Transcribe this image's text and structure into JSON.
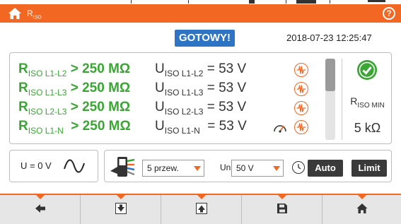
{
  "header": {
    "title_main": "R",
    "title_sub": "ISO",
    "home_icon": "home-icon",
    "help_label": "?"
  },
  "status": {
    "badge": "GOTOWY!",
    "datetime": "2018-07-23 12:25:47"
  },
  "results": [
    {
      "r_main": "R",
      "r_sub": "ISO L1-L2",
      "r_value": " > 250 MΩ",
      "u_main": "U",
      "u_sub": "ISO L1-L2",
      "u_value": " = 53 V",
      "icon": "waveform-icon"
    },
    {
      "r_main": "R",
      "r_sub": "ISO L1-L3",
      "r_value": " > 250 MΩ",
      "u_main": "U",
      "u_sub": "ISO L1-L3",
      "u_value": " = 53 V",
      "icon": "waveform-icon"
    },
    {
      "r_main": "R",
      "r_sub": "ISO L2-L3",
      "r_value": " > 250 MΩ",
      "u_main": "U",
      "u_sub": "ISO L2-L3",
      "u_value": " = 53 V",
      "icon": "waveform-icon"
    },
    {
      "r_main": "R",
      "r_sub": "ISO L1-N",
      "r_value": "  > 250 MΩ",
      "u_main": "U",
      "u_sub": "ISO L1-N",
      "u_value": "  = 53 V",
      "icon": "waveform-icon",
      "extra_icon": "gauge-icon"
    }
  ],
  "summary": {
    "ok_icon": "check-circle-icon",
    "min_label_main": "R",
    "min_label_sub": "ISO MIN",
    "min_value": "5 kΩ"
  },
  "voltage": {
    "label": "U = 0 V",
    "icon": "sine-wave-icon"
  },
  "settings": {
    "probe_icon": "probe-adapter-icon",
    "mode_value": "5 przew.",
    "un_label": "Un",
    "un_value": "50 V",
    "clock_icon": "clock-icon",
    "auto_label": "Auto",
    "limit_label": "Limit"
  },
  "toolbar": {
    "buttons": [
      "arrow-left-icon",
      "scroll-down-icon",
      "scroll-up-icon",
      "save-icon",
      "home-icon"
    ]
  },
  "colors": {
    "accent": "#f26722",
    "ok_green": "#3aa634",
    "badge_blue": "#2e74c4",
    "button_dark": "#3a3a3a"
  }
}
